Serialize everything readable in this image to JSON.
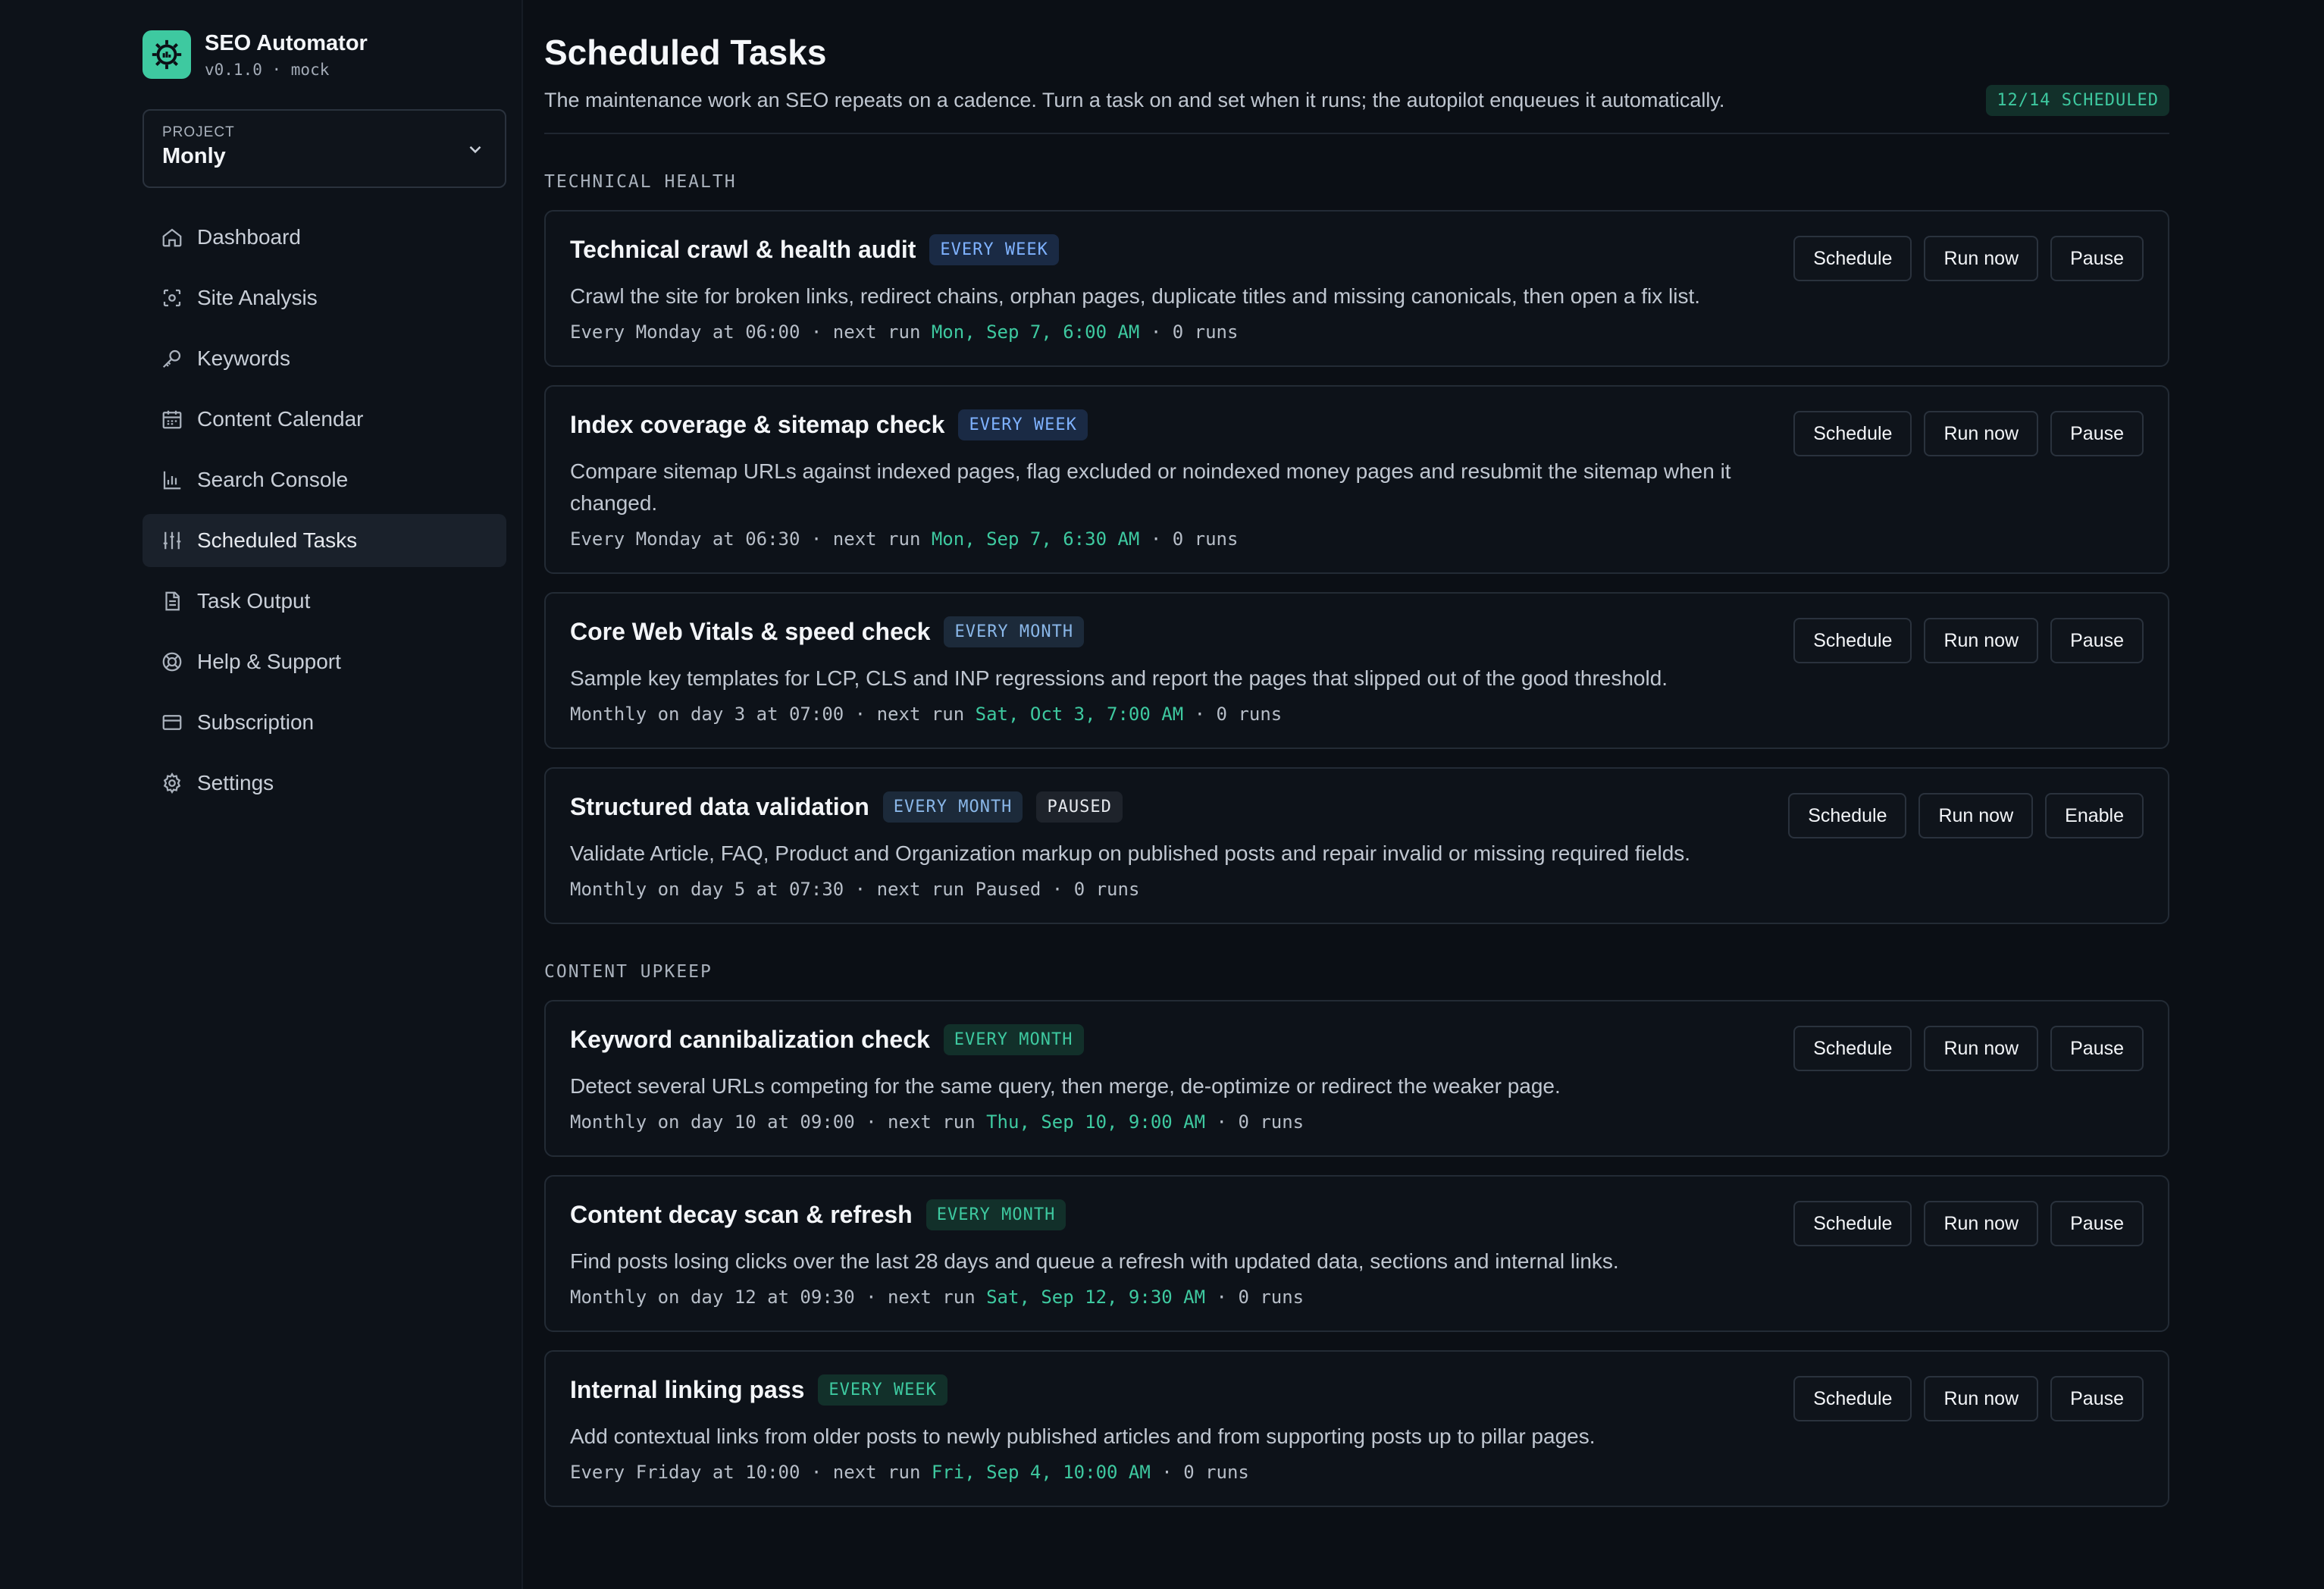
{
  "brand": {
    "name": "SEO Automator",
    "version": "v0.1.0 · mock"
  },
  "project": {
    "label": "PROJECT",
    "value": "Monly"
  },
  "nav": [
    {
      "label": "Dashboard",
      "icon": "home-icon"
    },
    {
      "label": "Site Analysis",
      "icon": "scan-icon"
    },
    {
      "label": "Keywords",
      "icon": "key-icon"
    },
    {
      "label": "Content Calendar",
      "icon": "calendar-icon"
    },
    {
      "label": "Search Console",
      "icon": "bar-chart-icon"
    },
    {
      "label": "Scheduled Tasks",
      "icon": "sliders-icon",
      "active": true
    },
    {
      "label": "Task Output",
      "icon": "document-icon"
    },
    {
      "label": "Help & Support",
      "icon": "lifebuoy-icon"
    },
    {
      "label": "Subscription",
      "icon": "credit-card-icon"
    },
    {
      "label": "Settings",
      "icon": "gear-icon"
    }
  ],
  "page": {
    "title": "Scheduled Tasks",
    "subtitle": "The maintenance work an SEO repeats on a cadence. Turn a task on and set when it runs; the autopilot enqueues it automatically.",
    "count_badge": "12/14 SCHEDULED"
  },
  "sections": [
    {
      "label": "TECHNICAL HEALTH",
      "tasks": [
        {
          "title": "Technical crawl & health audit",
          "cadence": "EVERY WEEK",
          "desc": "Crawl the site for broken links, redirect chains, orphan pages, duplicate titles and missing canonicals, then open a fix list.",
          "schedule_text": "Every Monday at 06:00",
          "next_label": "next run",
          "next_run": "Mon, Sep 7, 6:00 AM",
          "runs": "0 runs",
          "buttons": [
            "Schedule",
            "Run now",
            "Pause"
          ]
        },
        {
          "title": "Index coverage & sitemap check",
          "cadence": "EVERY WEEK",
          "desc": "Compare sitemap URLs against indexed pages, flag excluded or noindexed money pages and resubmit the sitemap when it changed.",
          "schedule_text": "Every Monday at 06:30",
          "next_label": "next run",
          "next_run": "Mon, Sep 7, 6:30 AM",
          "runs": "0 runs",
          "buttons": [
            "Schedule",
            "Run now",
            "Pause"
          ]
        },
        {
          "title": "Core Web Vitals & speed check",
          "cadence": "EVERY MONTH",
          "desc": "Sample key templates for LCP, CLS and INP regressions and report the pages that slipped out of the good threshold.",
          "schedule_text": "Monthly on day 3 at 07:00",
          "next_label": "next run",
          "next_run": "Sat, Oct 3, 7:00 AM",
          "runs": "0 runs",
          "buttons": [
            "Schedule",
            "Run now",
            "Pause"
          ]
        },
        {
          "title": "Structured data validation",
          "cadence": "EVERY MONTH",
          "status": "PAUSED",
          "desc": "Validate Article, FAQ, Product and Organization markup on published posts and repair invalid or missing required fields.",
          "schedule_text": "Monthly on day 5 at 07:30",
          "next_label": "next run",
          "next_run": "Paused",
          "runs": "0 runs",
          "buttons": [
            "Schedule",
            "Run now",
            "Enable"
          ]
        }
      ]
    },
    {
      "label": "CONTENT UPKEEP",
      "tasks": [
        {
          "title": "Keyword cannibalization check",
          "cadence": "EVERY MONTH",
          "desc": "Detect several URLs competing for the same query, then merge, de-optimize or redirect the weaker page.",
          "schedule_text": "Monthly on day 10 at 09:00",
          "next_label": "next run",
          "next_run": "Thu, Sep 10, 9:00 AM",
          "runs": "0 runs",
          "buttons": [
            "Schedule",
            "Run now",
            "Pause"
          ]
        },
        {
          "title": "Content decay scan & refresh",
          "cadence": "EVERY MONTH",
          "desc": "Find posts losing clicks over the last 28 days and queue a refresh with updated data, sections and internal links.",
          "schedule_text": "Monthly on day 12 at 09:30",
          "next_label": "next run",
          "next_run": "Sat, Sep 12, 9:30 AM",
          "runs": "0 runs",
          "buttons": [
            "Schedule",
            "Run now",
            "Pause"
          ]
        },
        {
          "title": "Internal linking pass",
          "cadence": "EVERY WEEK",
          "desc": "Add contextual links from older posts to newly published articles and from supporting posts up to pillar pages.",
          "schedule_text": "Every Friday at 10:00",
          "next_label": "next run",
          "next_run": "Fri, Sep 4, 10:00 AM",
          "runs": "0 runs",
          "buttons": [
            "Schedule",
            "Run now",
            "Pause"
          ]
        }
      ]
    }
  ]
}
